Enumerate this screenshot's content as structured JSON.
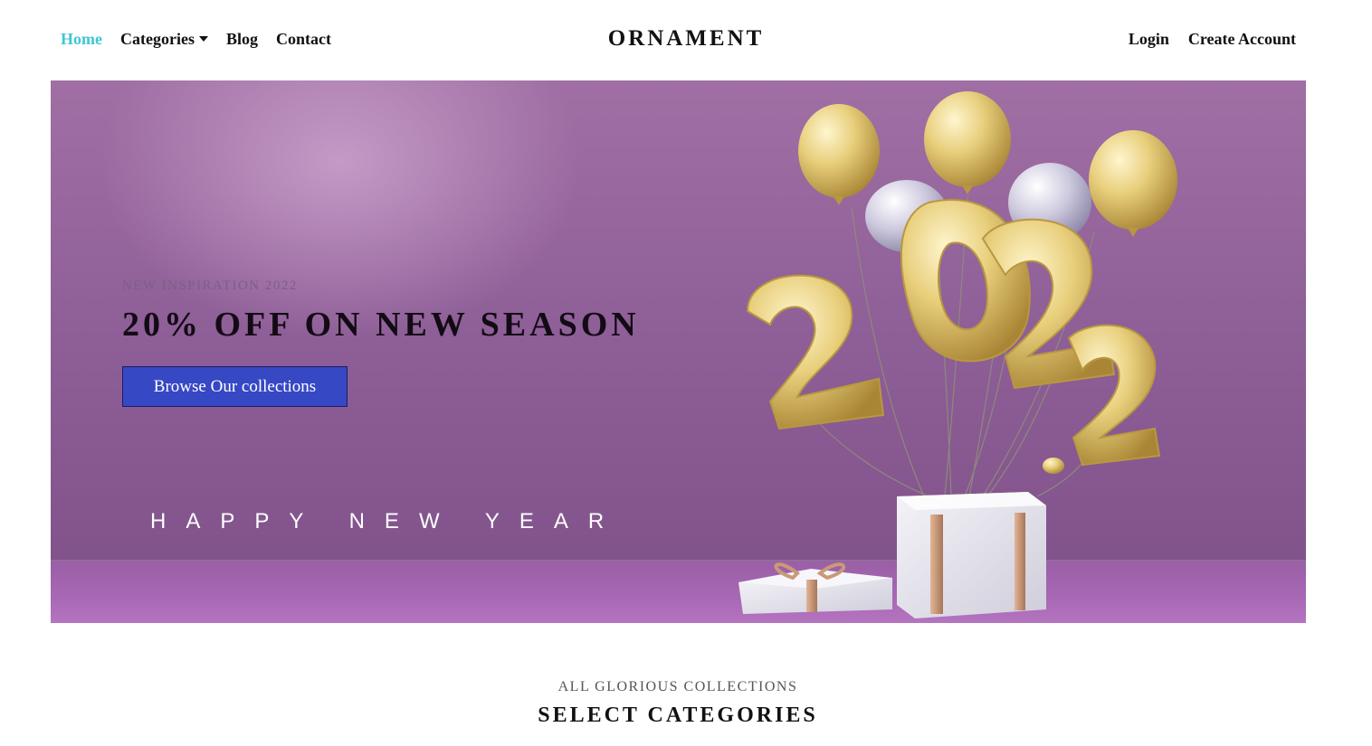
{
  "nav": {
    "left": [
      {
        "label": "Home",
        "active": true
      },
      {
        "label": "Categories",
        "dropdown": true
      },
      {
        "label": "Blog"
      },
      {
        "label": "Contact"
      }
    ],
    "brand": "ORNAMENT",
    "right": [
      {
        "label": "Login"
      },
      {
        "label": "Create Account"
      }
    ]
  },
  "hero": {
    "eyebrow": "NEW INSPIRATION 2022",
    "title": "20% OFF ON NEW SEASON",
    "button_label": "Browse Our collections",
    "greeting": "HAPPY NEW YEAR",
    "art": {
      "year_digits": [
        "2",
        "0",
        "2",
        "2"
      ],
      "colors": {
        "gold": "#e6cf7a",
        "gold_dark": "#b9973f",
        "silver": "#c9c6d8",
        "gift_white": "#e8e7ef",
        "ribbon": "#c99a78"
      }
    }
  },
  "collections": {
    "eyebrow": "ALL GLORIOUS COLLECTIONS",
    "title": "SELECT CATEGORIES"
  },
  "colors": {
    "nav_active": "#3ec7d3",
    "button_bg": "#3748c4",
    "hero_bg": "#8f5f98"
  }
}
